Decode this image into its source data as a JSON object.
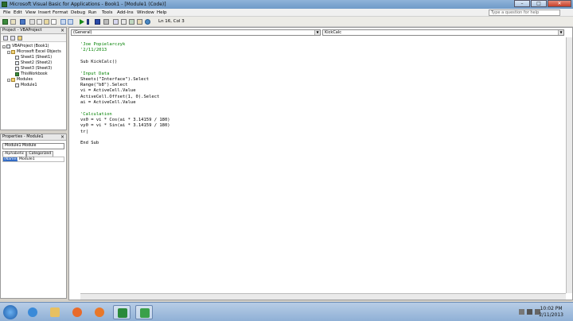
{
  "window": {
    "title": "Microsoft Visual Basic for Applications - Book1 - [Module1 (Code)]",
    "controls": [
      "minimize-icon",
      "maximize-icon",
      "close-icon"
    ]
  },
  "menu": {
    "items": [
      "File",
      "Edit",
      "View",
      "Insert",
      "Format",
      "Debug",
      "Run",
      "Tools",
      "Add-Ins",
      "Window",
      "Help"
    ],
    "help_placeholder": "Type a question for help"
  },
  "toolbar": {
    "position": "Ln 16, Col 3"
  },
  "project_panel": {
    "title": "Project - VBAProject",
    "tree": [
      {
        "label": "VBAProject (Book1)",
        "level": 0,
        "icon": "project"
      },
      {
        "label": "Microsoft Excel Objects",
        "level": 1,
        "icon": "folder"
      },
      {
        "label": "Sheet1 (Sheet1)",
        "level": 2,
        "icon": "sheet"
      },
      {
        "label": "Sheet2 (Sheet2)",
        "level": 2,
        "icon": "sheet"
      },
      {
        "label": "Sheet3 (Sheet3)",
        "level": 2,
        "icon": "sheet"
      },
      {
        "label": "ThisWorkbook",
        "level": 2,
        "icon": "xl"
      },
      {
        "label": "Modules",
        "level": 1,
        "icon": "folder"
      },
      {
        "label": "Module1",
        "level": 2,
        "icon": "module"
      }
    ]
  },
  "properties_panel": {
    "title": "Properties - Module1",
    "selector": "Module1 Module",
    "tabs": [
      "Alphabetic",
      "Categorized"
    ],
    "row": {
      "name": "(Name)",
      "value": "Module1"
    }
  },
  "code_window": {
    "object_combo": "(General)",
    "proc_combo": "KickCalc",
    "lines": [
      {
        "text": "'Joe Popielarczyk",
        "type": "comment"
      },
      {
        "text": "'2/11/2013",
        "type": "comment"
      },
      {
        "text": "",
        "type": "plain"
      },
      {
        "text": "Sub KickCalc()",
        "type": "keyword"
      },
      {
        "text": "",
        "type": "plain"
      },
      {
        "text": "'Input Data",
        "type": "comment"
      },
      {
        "text": "Sheets(\"Interface\").Select",
        "type": "plain"
      },
      {
        "text": "Range(\"b8\").Select",
        "type": "plain"
      },
      {
        "text": "vi = ActiveCell.Value",
        "type": "plain"
      },
      {
        "text": "ActiveCell.Offset(1, 0).Select",
        "type": "plain"
      },
      {
        "text": "ai = ActiveCell.Value",
        "type": "plain"
      },
      {
        "text": "",
        "type": "plain"
      },
      {
        "text": "'Calculation",
        "type": "comment"
      },
      {
        "text": "vx0 = vi * Cos(ai * 3.14159 / 180)",
        "type": "plain"
      },
      {
        "text": "vy0 = vi * Sin(ai * 3.14159 / 180)",
        "type": "plain"
      },
      {
        "text": "tr|",
        "type": "plain"
      },
      {
        "text": "",
        "type": "plain"
      },
      {
        "text": "End Sub",
        "type": "keyword"
      }
    ]
  },
  "taskbar": {
    "apps": [
      "start-orb",
      "ie-icon",
      "explorer-icon",
      "firefox-icon",
      "excel-icon",
      "vba-icon"
    ],
    "clock_time": "10:02 PM",
    "clock_date": "2/11/2013"
  }
}
